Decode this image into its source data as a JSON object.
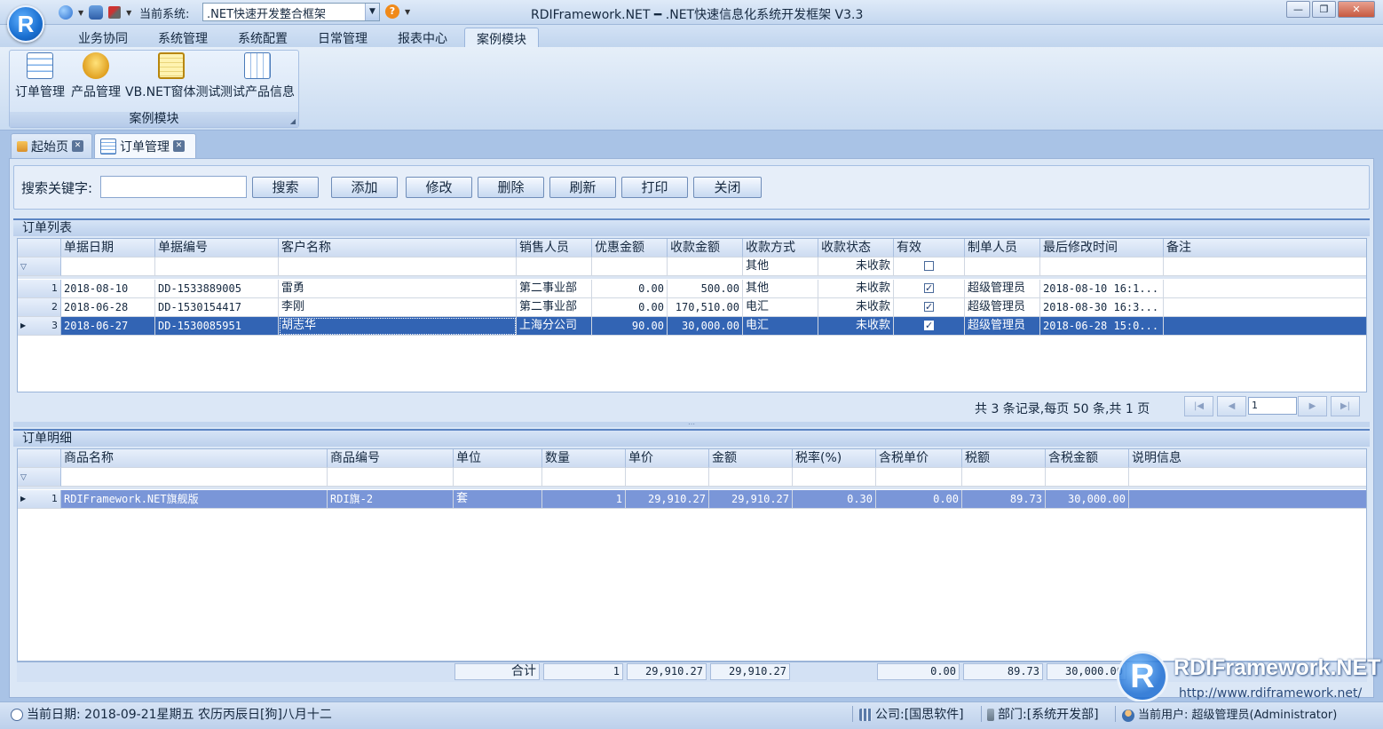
{
  "window": {
    "title": "RDIFramework.NET ━ .NET快速信息化系统开发框架 V3.3",
    "system_label": "当前系统:",
    "system_value": ".NET快速开发整合框架",
    "minimize": "—",
    "restore": "❐",
    "close": "✕"
  },
  "ribbon": {
    "tabs": [
      "业务协同",
      "系统管理",
      "系统配置",
      "日常管理",
      "报表中心",
      "案例模块"
    ],
    "active_tab": "案例模块",
    "group_caption": "案例模块",
    "buttons": [
      {
        "label": "订单管理",
        "icon": "order-grid-icon"
      },
      {
        "label": "产品管理",
        "icon": "coins-icon"
      },
      {
        "label": "VB.NET窗体测试",
        "icon": "notebook-icon"
      },
      {
        "label": "测试产品信息",
        "icon": "table-icon"
      }
    ]
  },
  "doc_tabs": [
    {
      "label": "起始页",
      "icon": "home-icon"
    },
    {
      "label": "订单管理",
      "icon": "order-grid-icon"
    }
  ],
  "toolbar": {
    "search_label": "搜索关键字:",
    "search_value": "",
    "buttons": [
      "搜索",
      "添加",
      "修改",
      "删除",
      "刷新",
      "打印",
      "关闭"
    ]
  },
  "orders": {
    "title": "订单列表",
    "columns": [
      "单据日期",
      "单据编号",
      "客户名称",
      "销售人员",
      "优惠金额",
      "收款金额",
      "收款方式",
      "收款状态",
      "有效",
      "制单人员",
      "最后修改时间",
      "备注"
    ],
    "filter": {
      "payment_method": "其他",
      "payment_status": "未收款",
      "valid": false
    },
    "rows": [
      {
        "no": "1",
        "date": "2018-08-10",
        "code": "DD-1533889005",
        "customer": "雷勇",
        "sales": "第二事业部",
        "discount": "0.00",
        "received": "500.00",
        "method": "其他",
        "status": "未收款",
        "valid": true,
        "maker": "超级管理员",
        "modified": "2018-08-10 16:1...",
        "remark": ""
      },
      {
        "no": "2",
        "date": "2018-06-28",
        "code": "DD-1530154417",
        "customer": "李刚",
        "sales": "第二事业部",
        "discount": "0.00",
        "received": "170,510.00",
        "method": "电汇",
        "status": "未收款",
        "valid": true,
        "maker": "超级管理员",
        "modified": "2018-08-30 16:3...",
        "remark": ""
      },
      {
        "no": "3",
        "date": "2018-06-27",
        "code": "DD-1530085951",
        "customer": "胡志华",
        "sales": "上海分公司",
        "discount": "90.00",
        "received": "30,000.00",
        "method": "电汇",
        "status": "未收款",
        "valid": true,
        "maker": "超级管理员",
        "modified": "2018-06-28 15:0...",
        "remark": ""
      }
    ],
    "selected_row": 3,
    "pager": {
      "text": "共 3 条记录,每页 50 条,共 1 页",
      "page": "1"
    }
  },
  "details": {
    "title": "订单明细",
    "columns": [
      "商品名称",
      "商品编号",
      "单位",
      "数量",
      "单价",
      "金额",
      "税率(%)",
      "含税单价",
      "税额",
      "含税金额",
      "说明信息"
    ],
    "rows": [
      {
        "no": "1",
        "name": "RDIFramework.NET旗舰版",
        "code": "RDI旗-2",
        "unit": "套",
        "qty": "1",
        "price": "29,910.27",
        "amount": "29,910.27",
        "tax_rate": "0.30",
        "tax_price": "0.00",
        "tax": "89.73",
        "tax_amount": "30,000.00",
        "note": ""
      }
    ],
    "footer": {
      "label": "合计",
      "qty": "1",
      "price": "29,910.27",
      "amount": "29,910.27",
      "tax_price": "0.00",
      "tax": "89.73",
      "tax_amount": "30,000.00"
    }
  },
  "status": {
    "date": "当前日期: 2018-09-21星期五 农历丙辰日[狗]八月十二",
    "company": "公司:[国思软件]",
    "dept": "部门:[系统开发部]",
    "user": "当前用户: 超级管理员(Administrator)"
  },
  "watermark": {
    "logo_letter": "R",
    "brand": "RDIFramework.NET",
    "url": "http://www.rdiframework.net/"
  },
  "colors": {
    "selected_row": "#3264b4",
    "detail_selected_row": "#7a96d8",
    "accent": "#5b85c3"
  }
}
